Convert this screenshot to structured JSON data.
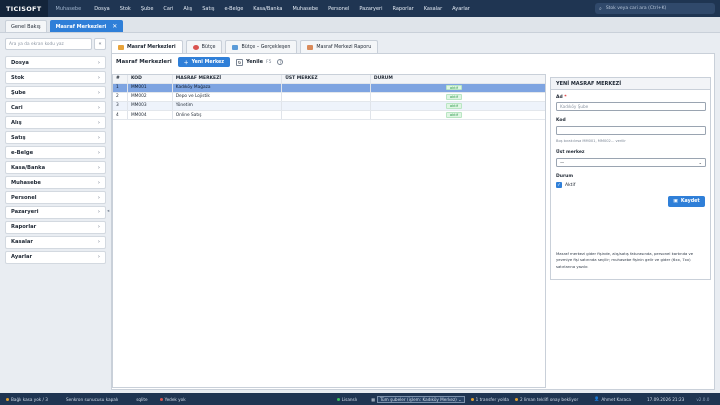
{
  "app": {
    "brand": "TICISOFT",
    "module": "Muhasebe"
  },
  "menu": [
    "Dosya",
    "Stok",
    "Şube",
    "Cari",
    "Alış",
    "Satış",
    "e-Belge",
    "Kasa/Banka",
    "Muhasebe",
    "Personel",
    "Pazaryeri",
    "Raporlar",
    "Kasalar",
    "Ayarlar"
  ],
  "search": {
    "placeholder": "Stok veya cari ara (Ctrl+K)",
    "icon": "search-icon"
  },
  "doc_tabs": [
    {
      "label": "Genel Bakış",
      "active": false
    },
    {
      "label": "Masraf Merkezleri",
      "active": true,
      "close": "✕"
    }
  ],
  "sidebar": {
    "search_placeholder": "Ara ya da ekran kodu yaz",
    "collapse_icon": "«",
    "items": [
      "Dosya",
      "Stok",
      "Şube",
      "Cari",
      "Alış",
      "Satış",
      "e-Belge",
      "Kasa/Banka",
      "Muhasebe",
      "Personel",
      "Pazaryeri",
      "Raporlar",
      "Kasalar",
      "Ayarlar"
    ]
  },
  "subtabs": [
    {
      "label": "Masraf Merkezleri",
      "active": true,
      "color": "#e8a33a"
    },
    {
      "label": "Bütçe",
      "active": false,
      "color": "#d9534f"
    },
    {
      "label": "Bütçe – Gerçekleşen",
      "active": false,
      "color": "#5a9bd8"
    },
    {
      "label": "Masraf Merkezi Raporu",
      "active": false,
      "color": "#d98a5a"
    }
  ],
  "toolbar": {
    "title": "Masraf Merkezleri",
    "new_label": "Yeni Merkez",
    "refresh_label": "Yenile",
    "refresh_shortcut": "F5",
    "help": "?"
  },
  "grid": {
    "columns": [
      "#",
      "KOD",
      "MASRAF MERKEZİ",
      "ÜST MERKEZ",
      "DURUM"
    ],
    "rows": [
      {
        "n": "1",
        "code": "MM001",
        "name": "Kadıköy Mağaza",
        "parent": "",
        "status": "aktif"
      },
      {
        "n": "2",
        "code": "MM002",
        "name": "Depo ve Lojistik",
        "parent": "",
        "status": "aktif"
      },
      {
        "n": "3",
        "code": "MM003",
        "name": "Yönetim",
        "parent": "",
        "status": "aktif"
      },
      {
        "n": "4",
        "code": "MM004",
        "name": "Online Satış",
        "parent": "",
        "status": "aktif"
      }
    ]
  },
  "form": {
    "title": "YENİ MASRAF MERKEZİ",
    "name_label": "Ad",
    "required_mark": "*",
    "name_placeholder": "Kadıköy Şube",
    "code_label": "Kod",
    "code_hint": "Boş bırakılırsa MM001, MM002… verilir",
    "parent_label": "Üst merkez",
    "parent_value": "—",
    "status_label": "Durum",
    "active_label": "Aktif",
    "active_checked": true,
    "save_label": "Kaydet",
    "description": "Masraf merkezi gider fişinde, alış/satış faturasında, personel kartında ve yevmiye fişi satırında seçilir; muhasebe fişinin gelir ve gider (6xx, 7xx) satırlarına yazılır."
  },
  "statusbar": {
    "items": [
      {
        "text": "Bağlı kasa yok / 3",
        "dot": "#e0a030"
      },
      {
        "text": "Senkron sunucusu kapalı",
        "dot": ""
      },
      {
        "text": "sqlite",
        "dot": ""
      },
      {
        "text": "Yedek yok",
        "dot": "#d9534f"
      },
      {
        "text": "Lisanslı",
        "dot": "#3cbf5c"
      },
      {
        "text": "Tüm şubeler (işlem: Kadıköy Merkez)",
        "dot": ""
      },
      {
        "text": "1 transfer yolda",
        "dot": "#e0a030"
      },
      {
        "text": "2 liman teklifi onay bekliyor",
        "dot": "#e0a030"
      },
      {
        "text": "Ahmet Karaca",
        "dot": ""
      },
      {
        "text": "17.09.2026 21:23",
        "dot": ""
      },
      {
        "text": "v2.0.0",
        "dot": ""
      }
    ]
  }
}
